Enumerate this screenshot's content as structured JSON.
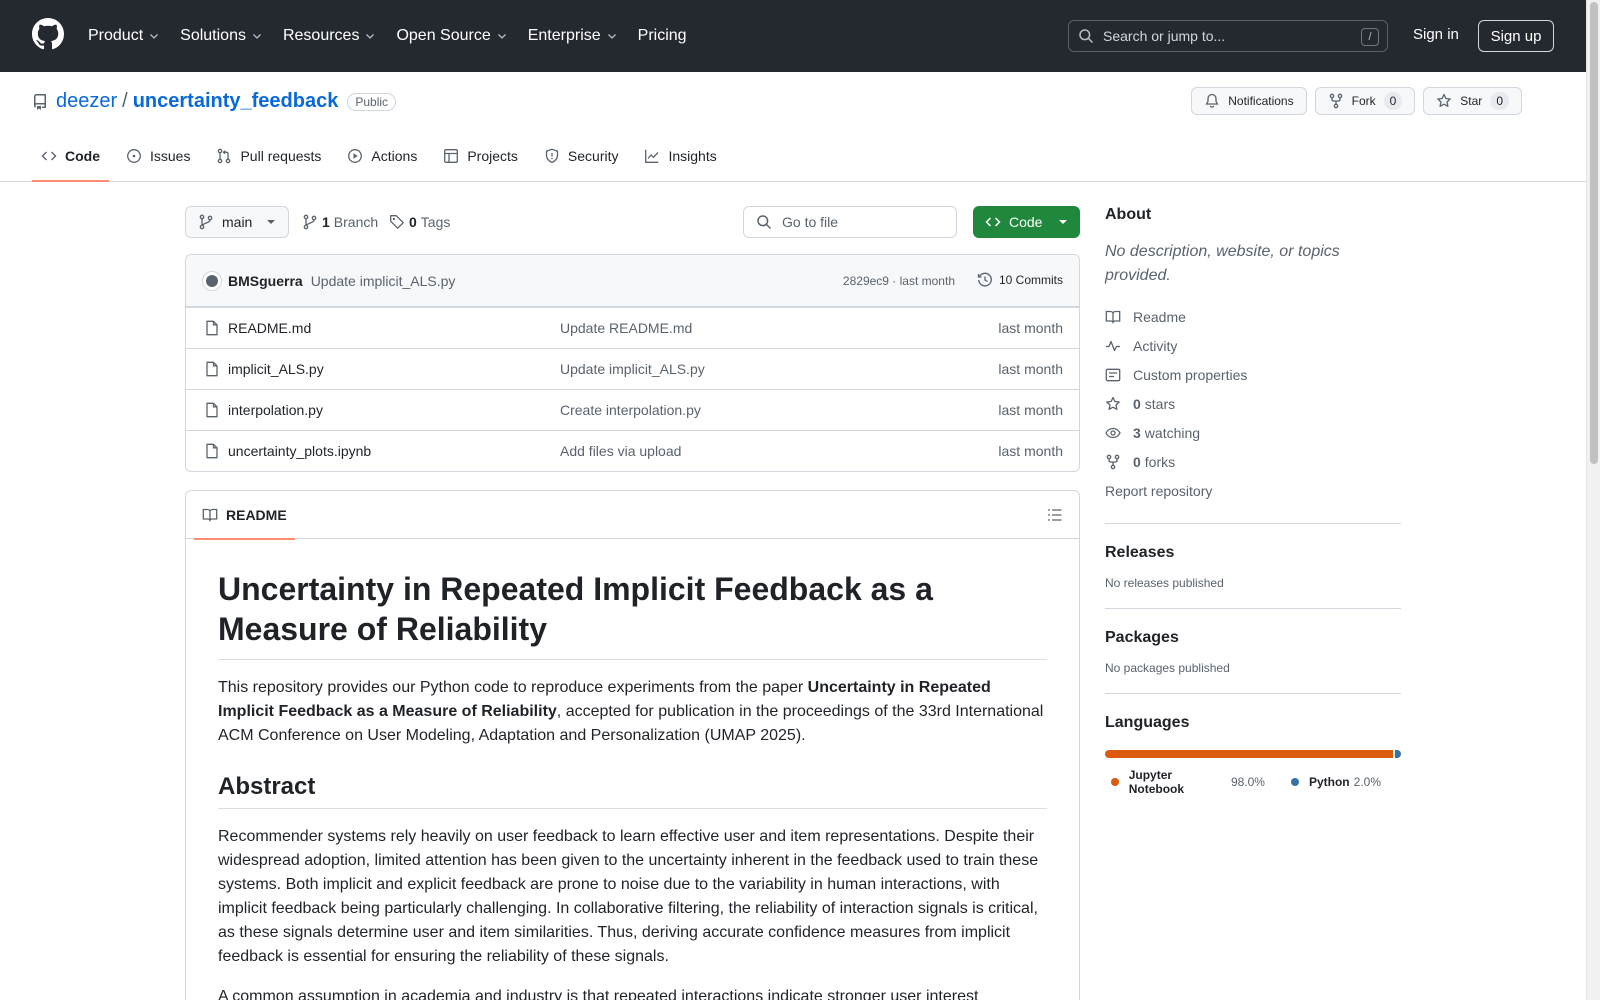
{
  "header": {
    "nav": [
      {
        "label": "Product",
        "has_menu": true
      },
      {
        "label": "Solutions",
        "has_menu": true
      },
      {
        "label": "Resources",
        "has_menu": true
      },
      {
        "label": "Open Source",
        "has_menu": true
      },
      {
        "label": "Enterprise",
        "has_menu": true
      },
      {
        "label": "Pricing",
        "has_menu": false
      }
    ],
    "search_placeholder": "Search or jump to...",
    "search_shortcut": "/",
    "sign_in": "Sign in",
    "sign_up": "Sign up"
  },
  "repo": {
    "owner": "deezer",
    "separator": "/",
    "name": "uncertainty_feedback",
    "visibility": "Public",
    "actions": {
      "notifications": "Notifications",
      "fork": "Fork",
      "fork_count": "0",
      "star": "Star",
      "star_count": "0"
    },
    "tabs": [
      {
        "label": "Code",
        "icon": "code-icon",
        "active": true
      },
      {
        "label": "Issues",
        "icon": "issue-icon",
        "active": false
      },
      {
        "label": "Pull requests",
        "icon": "pull-request-icon",
        "active": false
      },
      {
        "label": "Actions",
        "icon": "play-icon",
        "active": false
      },
      {
        "label": "Projects",
        "icon": "table-icon",
        "active": false
      },
      {
        "label": "Security",
        "icon": "shield-icon",
        "active": false
      },
      {
        "label": "Insights",
        "icon": "graph-icon",
        "active": false
      }
    ]
  },
  "toolbar": {
    "branch": "main",
    "branch_count": "1",
    "branch_label": "Branch",
    "tag_count": "0",
    "tag_label": "Tags",
    "goto_placeholder": "Go to file",
    "code_button": "Code"
  },
  "commit": {
    "author": "BMSguerra",
    "message": "Update implicit_ALS.py",
    "meta": "2829ec9 · last month",
    "count": "10 Commits"
  },
  "files": [
    {
      "name": "README.md",
      "message": "Update README.md",
      "time": "last month"
    },
    {
      "name": "implicit_ALS.py",
      "message": "Update implicit_ALS.py",
      "time": "last month"
    },
    {
      "name": "interpolation.py",
      "message": "Create interpolation.py",
      "time": "last month"
    },
    {
      "name": "uncertainty_plots.ipynb",
      "message": "Add files via upload",
      "time": "last month"
    }
  ],
  "readme": {
    "tab_label": "README",
    "title": "Uncertainty in Repeated Implicit Feedback as a Measure of Reliability",
    "intro_before": "This repository provides our Python code to reproduce experiments from the paper ",
    "intro_bold": "Uncertainty in Repeated Implicit Feedback as a Measure of Reliability",
    "intro_after": ", accepted for publication in the proceedings of the 33rd International ACM Conference on User Modeling, Adaptation and Personalization (UMAP 2025).",
    "abstract_heading": "Abstract",
    "abstract_p1": "Recommender systems rely heavily on user feedback to learn effective user and item representations. Despite their widespread adoption, limited attention has been given to the uncertainty inherent in the feedback used to train these systems. Both implicit and explicit feedback are prone to noise due to the variability in human interactions, with implicit feedback being particularly challenging. In collaborative filtering, the reliability of interaction signals is critical, as these signals determine user and item similarities. Thus, deriving accurate confidence measures from implicit feedback is essential for ensuring the reliability of these signals.",
    "abstract_p2": "A common assumption in academia and industry is that repeated interactions indicate stronger user interest"
  },
  "sidebar": {
    "about_title": "About",
    "about_desc": "No description, website, or topics provided.",
    "links": [
      {
        "icon": "book-icon",
        "count": "",
        "label": "Readme"
      },
      {
        "icon": "pulse-icon",
        "count": "",
        "label": "Activity"
      },
      {
        "icon": "note-icon",
        "count": "",
        "label": "Custom properties"
      },
      {
        "icon": "star-icon",
        "count": "0",
        "label": "stars"
      },
      {
        "icon": "eye-icon",
        "count": "3",
        "label": "watching"
      },
      {
        "icon": "fork-icon",
        "count": "0",
        "label": "forks"
      }
    ],
    "report": "Report repository",
    "releases_title": "Releases",
    "releases_empty": "No releases published",
    "packages_title": "Packages",
    "packages_empty": "No packages published",
    "languages_title": "Languages",
    "languages": [
      {
        "name": "Jupyter Notebook",
        "percent": "98.0%",
        "value": 98.0,
        "color": "#DA5B0B"
      },
      {
        "name": "Python",
        "percent": "2.0%",
        "value": 2.0,
        "color": "#3572A5"
      }
    ]
  }
}
